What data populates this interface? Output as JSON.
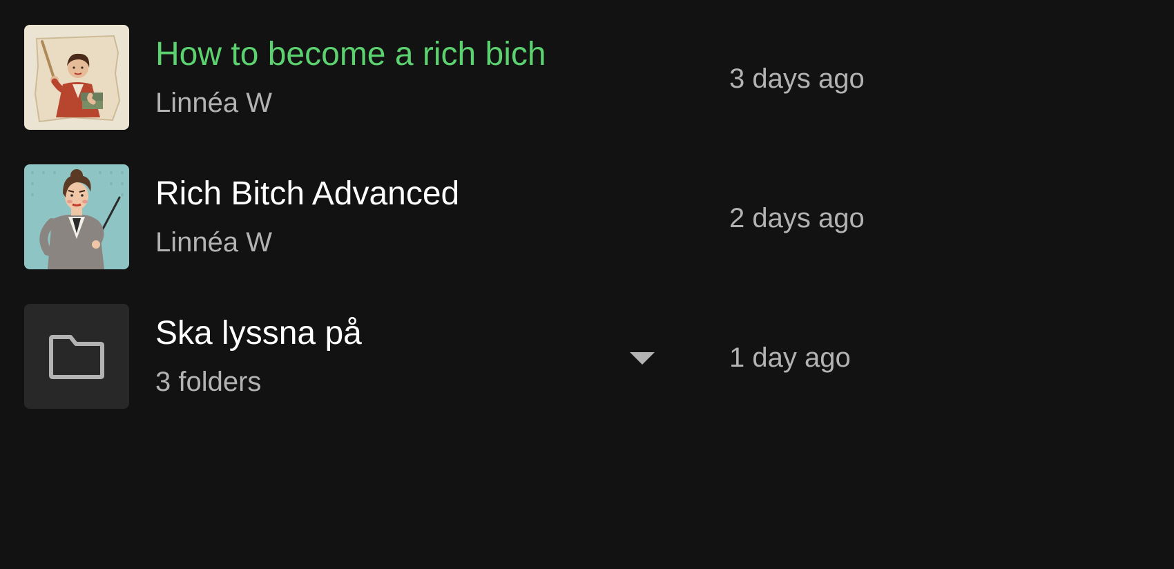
{
  "library": {
    "items": [
      {
        "title": "How to become a rich bich",
        "subtitle": "Linnéa W",
        "date_added": "3 days ago",
        "type": "playlist",
        "now_playing": true,
        "cover_icon": "cover-art-vintage-teacher"
      },
      {
        "title": "Rich Bitch Advanced",
        "subtitle": "Linnéa W",
        "date_added": "2 days ago",
        "type": "playlist",
        "now_playing": false,
        "cover_icon": "cover-art-pop-art-teacher"
      },
      {
        "title": "Ska lyssna på",
        "subtitle": "3 folders",
        "date_added": "1 day ago",
        "type": "folder",
        "now_playing": false,
        "cover_icon": "folder-icon",
        "expand_icon": "caret-down-icon"
      }
    ]
  },
  "colors": {
    "background": "#121212",
    "now_playing_text": "#5cd16f",
    "primary_text": "#ffffff",
    "secondary_text": "#b3b3b3",
    "folder_tile": "#282828"
  }
}
